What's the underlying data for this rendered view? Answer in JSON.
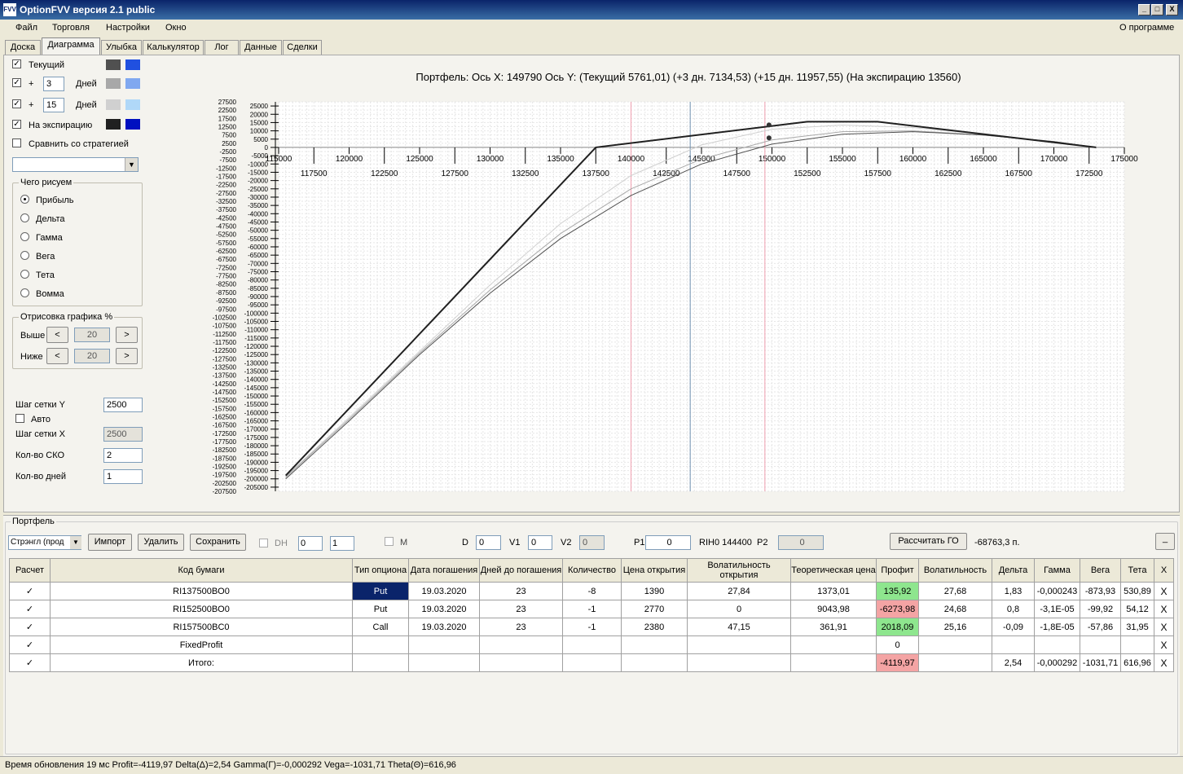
{
  "window": {
    "title": "OptionFVV версия 2.1 public",
    "icon": "FVV",
    "minimize": "_",
    "maximize": "□",
    "close": "X"
  },
  "menu": {
    "items": [
      "Файл",
      "Торговля",
      "Настройки",
      "Окно"
    ],
    "about": "О программе"
  },
  "tabs": [
    "Доска",
    "Диаграмма",
    "Улыбка",
    "Калькулятор",
    "Лог",
    "Данные",
    "Сделки"
  ],
  "active_tab": "Диаграмма",
  "side": {
    "current_label": "Текущий",
    "plus": "+",
    "days1_value": "3",
    "days2_value": "15",
    "days_label": "Дней",
    "expiry_label": "На экспирацию",
    "compare_label": "Сравнить со стратегией",
    "what_title": "Чего рисуем",
    "radios": [
      "Прибыль",
      "Дельта",
      "Гамма",
      "Вега",
      "Тета",
      "Вомма"
    ],
    "selected_radio": "Прибыль",
    "render_title": "Отрисовка графика %",
    "above_label": "Выше",
    "below_label": "Ниже",
    "above_value": "20",
    "below_value": "20",
    "arrow_left": "<",
    "arrow_right": ">",
    "grid_y_label": "Шаг сетки Y",
    "grid_y_value": "2500",
    "auto_label": "Авто",
    "grid_x_label": "Шаг сетки X",
    "grid_x_value": "2500",
    "sko_label": "Кол-во СКО",
    "sko_value": "2",
    "days_count_label": "Кол-во дней",
    "days_count_value": "1",
    "colors": {
      "current": [
        "#505050",
        "#2050e0"
      ],
      "days1": [
        "#a8a8a8",
        "#80a8f0"
      ],
      "days2": [
        "#d0d0d0",
        "#b0d8f8"
      ],
      "expiry": [
        "#202020",
        "#0010c0"
      ]
    }
  },
  "chart_data": {
    "type": "line",
    "title": "Портфель: Ось X: 149790 Ось Y:  (Текущий 5761,01)  (+3 дн. 7134,53)  (+15 дн. 11957,55)  (На экспирацию 13560)",
    "xlim": [
      115000,
      175000
    ],
    "ylim": [
      -207500,
      27500
    ],
    "x_ticks_major": [
      115000,
      120000,
      125000,
      130000,
      135000,
      140000,
      145000,
      150000,
      155000,
      160000,
      165000,
      170000,
      175000
    ],
    "x_ticks_minor": [
      117500,
      122500,
      127500,
      132500,
      137500,
      142500,
      147500,
      152500,
      157500,
      162500,
      167500,
      172500
    ],
    "y_ticks_left": [
      27500,
      22500,
      17500,
      12500,
      7500,
      2500,
      -2500,
      -7500,
      -12500,
      -17500,
      -22500,
      -27500,
      -32500,
      -37500,
      -42500,
      -47500,
      -52500,
      -57500,
      -62500,
      -67500,
      -72500,
      -77500,
      -82500,
      -87500,
      -92500,
      -97500,
      -102500,
      -107500,
      -112500,
      -117500,
      -122500,
      -127500,
      -132500,
      -137500,
      -142500,
      -147500,
      -152500,
      -157500,
      -162500,
      -167500,
      -172500,
      -177500,
      -182500,
      -187500,
      -192500,
      -197500,
      -202500,
      -207500
    ],
    "y_ticks_right": [
      25000,
      20000,
      15000,
      10000,
      5000,
      0,
      -5000,
      -10000,
      -15000,
      -20000,
      -25000,
      -30000,
      -35000,
      -40000,
      -45000,
      -50000,
      -55000,
      -60000,
      -65000,
      -70000,
      -75000,
      -80000,
      -85000,
      -90000,
      -95000,
      -100000,
      -105000,
      -110000,
      -115000,
      -120000,
      -125000,
      -130000,
      -135000,
      -140000,
      -145000,
      -150000,
      -155000,
      -160000,
      -165000,
      -170000,
      -175000,
      -180000,
      -185000,
      -190000,
      -195000,
      -200000,
      -205000
    ],
    "vlines": [
      {
        "x": 140000,
        "color": "#f0a0b0"
      },
      {
        "x": 144200,
        "color": "#7090b0"
      },
      {
        "x": 149500,
        "color": "#f0a0b0"
      }
    ],
    "series": [
      {
        "color": "#202020",
        "width": 2,
        "points": [
          [
            115500,
            -198000
          ],
          [
            137500,
            0
          ],
          [
            152500,
            15500
          ],
          [
            157500,
            15500
          ],
          [
            173000,
            0
          ]
        ]
      },
      {
        "color": "#505050",
        "width": 1,
        "points": [
          [
            115500,
            -200000
          ],
          [
            120000,
            -165000
          ],
          [
            125000,
            -125000
          ],
          [
            130000,
            -88000
          ],
          [
            135000,
            -55000
          ],
          [
            140000,
            -29000
          ],
          [
            145000,
            -10000
          ],
          [
            150000,
            2000
          ],
          [
            155000,
            8000
          ],
          [
            160000,
            9500
          ],
          [
            165000,
            7500
          ],
          [
            170000,
            3500
          ],
          [
            173000,
            0
          ]
        ]
      },
      {
        "color": "#a8a8a8",
        "width": 1,
        "points": [
          [
            115500,
            -199000
          ],
          [
            120000,
            -164000
          ],
          [
            125000,
            -124000
          ],
          [
            130000,
            -86000
          ],
          [
            135000,
            -52000
          ],
          [
            140000,
            -25000
          ],
          [
            145000,
            -7000
          ],
          [
            150000,
            4500
          ],
          [
            155000,
            9500
          ],
          [
            160000,
            10000
          ],
          [
            165000,
            7500
          ],
          [
            170000,
            3500
          ],
          [
            173000,
            0
          ]
        ]
      },
      {
        "color": "#d0d0d0",
        "width": 1,
        "points": [
          [
            115500,
            -198500
          ],
          [
            120000,
            -163000
          ],
          [
            125000,
            -123000
          ],
          [
            130000,
            -83000
          ],
          [
            135000,
            -46000
          ],
          [
            140000,
            -17000
          ],
          [
            145000,
            1500
          ],
          [
            150000,
            11000
          ],
          [
            155000,
            13500
          ],
          [
            160000,
            12000
          ],
          [
            165000,
            8000
          ],
          [
            170000,
            3500
          ],
          [
            173000,
            0
          ]
        ]
      }
    ],
    "markers": [
      {
        "x": 149790,
        "y": 13560
      },
      {
        "x": 149790,
        "y": 5761
      }
    ]
  },
  "portfolio": {
    "title": "Портфель",
    "select_value": "Стрэнгл (прод",
    "import": "Импорт",
    "delete": "Удалить",
    "save": "Сохранить",
    "dh_label": "DH",
    "spin1": "0",
    "spin2": "1",
    "m_label": "M",
    "d_label": "D",
    "d_value": "0",
    "v1_label": "V1",
    "v1_value": "0",
    "v2_label": "V2",
    "v2_value": "0",
    "p1_label": "P1",
    "p1_value": "0",
    "instrument": "RIH0 144400",
    "p2_label": "P2",
    "p2_value": "0",
    "calc_go": "Рассчитать ГО",
    "go_value": "-68763,3 п.",
    "min_btn": "_"
  },
  "table": {
    "headers": [
      "Расчет",
      "Код бумаги",
      "Тип опциона",
      "Дата погашения",
      "Дней до погашения",
      "Количество",
      "Цена открытия",
      "Волатильность открытия",
      "Теоретическая цена",
      "Профит",
      "Волатильность",
      "Дельта",
      "Гамма",
      "Вега",
      "Тета",
      "X"
    ],
    "rows": [
      {
        "check": "✓",
        "code": "RI137500BO0",
        "type": "Put",
        "date": "19.03.2020",
        "days": "23",
        "qty": "-8",
        "price": "1390",
        "vol_open": "27,84",
        "theo": "1373,01",
        "profit": "135,92",
        "vol": "27,68",
        "delta": "1,83",
        "gamma": "-0,000243",
        "vega": "-873,93",
        "theta": "530,89",
        "x": "X"
      },
      {
        "check": "✓",
        "code": "RI152500BO0",
        "type": "Put",
        "date": "19.03.2020",
        "days": "23",
        "qty": "-1",
        "price": "2770",
        "vol_open": "0",
        "theo": "9043,98",
        "profit": "-6273,98",
        "vol": "24,68",
        "delta": "0,8",
        "gamma": "-3,1E-05",
        "vega": "-99,92",
        "theta": "54,12",
        "x": "X"
      },
      {
        "check": "✓",
        "code": "RI157500BC0",
        "type": "Call",
        "date": "19.03.2020",
        "days": "23",
        "qty": "-1",
        "price": "2380",
        "vol_open": "47,15",
        "theo": "361,91",
        "profit": "2018,09",
        "vol": "25,16",
        "delta": "-0,09",
        "gamma": "-1,8E-05",
        "vega": "-57,86",
        "theta": "31,95",
        "x": "X"
      },
      {
        "check": "✓",
        "code": "FixedProfit",
        "type": "",
        "date": "",
        "days": "",
        "qty": "",
        "price": "",
        "vol_open": "",
        "theo": "",
        "profit": "0",
        "vol": "",
        "delta": "",
        "gamma": "",
        "vega": "",
        "theta": "",
        "x": "X"
      },
      {
        "check": "✓",
        "code": "Итого:",
        "type": "",
        "date": "",
        "days": "",
        "qty": "",
        "price": "",
        "vol_open": "",
        "theo": "",
        "profit": "-4119,97",
        "vol": "",
        "delta": "2,54",
        "gamma": "-0,000292",
        "vega": "-1031,71",
        "theta": "616,96",
        "x": "X"
      }
    ]
  },
  "status": "Время обновления 19 мс  Profit=-4119,97 Delta(Δ)=2,54 Gamma(Γ)=-0,000292 Vega=-1031,71 Theta(Θ)=616,96"
}
